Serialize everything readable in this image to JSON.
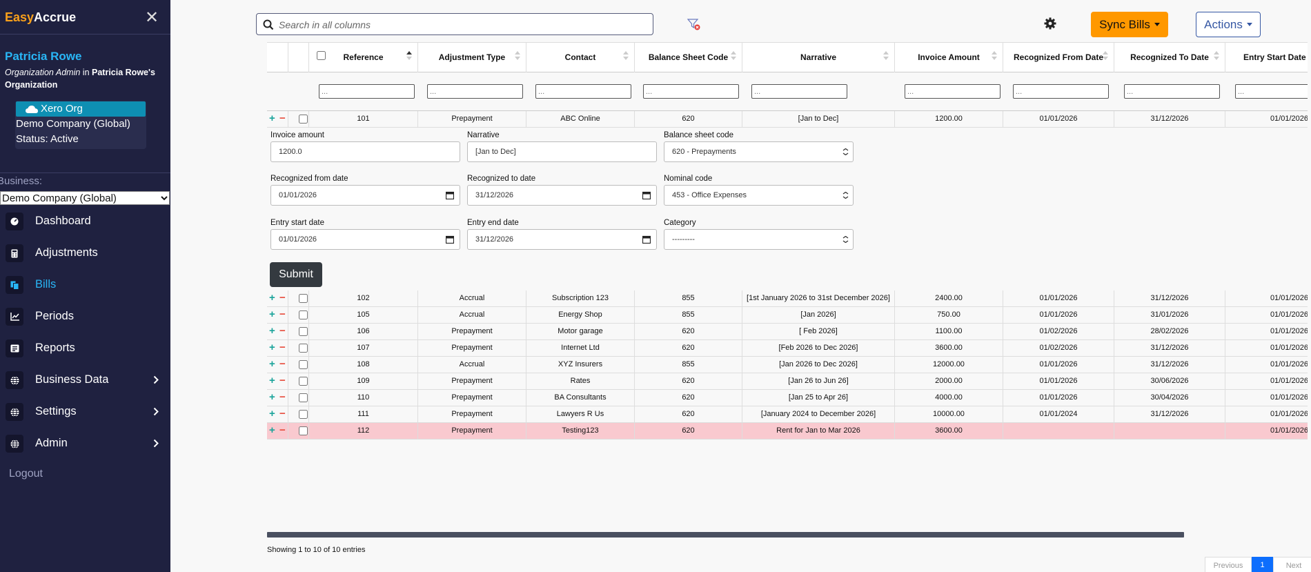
{
  "brand": {
    "part1": "Easy",
    "part2": "Accrue"
  },
  "user": {
    "name": "Patricia Rowe",
    "role": "Organization Admin",
    "in_text": " in ",
    "org_label": "Patricia Rowe's Organization"
  },
  "org": {
    "badge": "Xero Org",
    "name": "Demo Company (Global)",
    "status": "Status: Active"
  },
  "business": {
    "label": "Business:",
    "selected": "Demo Company (Global)"
  },
  "nav": [
    {
      "label": "Dashboard",
      "icon": "dashboard-icon"
    },
    {
      "label": "Adjustments",
      "icon": "calculator-icon"
    },
    {
      "label": "Bills",
      "icon": "bills-icon",
      "active": true
    },
    {
      "label": "Periods",
      "icon": "chart-icon"
    },
    {
      "label": "Reports",
      "icon": "report-icon"
    },
    {
      "label": "Business Data",
      "icon": "globe-icon",
      "expandable": true
    },
    {
      "label": "Settings",
      "icon": "globe-icon",
      "expandable": true
    },
    {
      "label": "Admin",
      "icon": "globe-icon",
      "expandable": true
    }
  ],
  "logout": "Logout",
  "search": {
    "placeholder": "Search in all columns"
  },
  "buttons": {
    "sync": "Sync Bills",
    "actions": "Actions",
    "submit": "Submit"
  },
  "table": {
    "columns": [
      "Reference",
      "Adjustment Type",
      "Contact",
      "Balance Sheet Code",
      "Narrative",
      "Invoice Amount",
      "Recognized From Date",
      "Recognized To Date",
      "Entry Start Date"
    ],
    "filter_placeholder": "...",
    "rows": [
      {
        "ref": "101",
        "type": "Prepayment",
        "contact": "ABC Online",
        "bsc": "620",
        "narr": "[Jan to Dec]",
        "amt": "1200.00",
        "from": "01/01/2026",
        "to": "31/12/2026",
        "start": "01/01/2026"
      },
      {
        "ref": "102",
        "type": "Accrual",
        "contact": "Subscription 123",
        "bsc": "855",
        "narr": "[1st January 2026 to 31st December 2026]",
        "amt": "2400.00",
        "from": "01/01/2026",
        "to": "31/12/2026",
        "start": "01/01/2026"
      },
      {
        "ref": "105",
        "type": "Accrual",
        "contact": "Energy Shop",
        "bsc": "855",
        "narr": "[Jan 2026]",
        "amt": "750.00",
        "from": "01/01/2026",
        "to": "31/01/2026",
        "start": "01/01/2026"
      },
      {
        "ref": "106",
        "type": "Prepayment",
        "contact": "Motor garage",
        "bsc": "620",
        "narr": "[ Feb 2026]",
        "amt": "1100.00",
        "from": "01/02/2026",
        "to": "28/02/2026",
        "start": "01/01/2026"
      },
      {
        "ref": "107",
        "type": "Prepayment",
        "contact": "Internet Ltd",
        "bsc": "620",
        "narr": "[Feb 2026 to Dec 2026]",
        "amt": "3600.00",
        "from": "01/02/2026",
        "to": "31/12/2026",
        "start": "01/01/2026"
      },
      {
        "ref": "108",
        "type": "Accrual",
        "contact": "XYZ Insurers",
        "bsc": "855",
        "narr": "[Jan 2026 to Dec 2026]",
        "amt": "12000.00",
        "from": "01/01/2026",
        "to": "31/12/2026",
        "start": "01/01/2026"
      },
      {
        "ref": "109",
        "type": "Prepayment",
        "contact": "Rates",
        "bsc": "620",
        "narr": "[Jan 26 to Jun 26]",
        "amt": "2000.00",
        "from": "01/01/2026",
        "to": "30/06/2026",
        "start": "01/01/2026"
      },
      {
        "ref": "110",
        "type": "Prepayment",
        "contact": "BA Consultants",
        "bsc": "620",
        "narr": "[Jan 25 to Apr 26]",
        "amt": "4000.00",
        "from": "01/01/2026",
        "to": "30/04/2026",
        "start": "01/01/2026"
      },
      {
        "ref": "111",
        "type": "Prepayment",
        "contact": "Lawyers R Us",
        "bsc": "620",
        "narr": "[January 2024 to December 2026]",
        "amt": "10000.00",
        "from": "01/01/2024",
        "to": "31/12/2026",
        "start": "01/01/2026"
      },
      {
        "ref": "112",
        "type": "Prepayment",
        "contact": "Testing123",
        "bsc": "620",
        "narr": "Rent for Jan to Mar 2026",
        "amt": "3600.00",
        "from": "",
        "to": "",
        "start": "01/01/2026",
        "highlight": true
      }
    ]
  },
  "form": {
    "invoice_amount_label": "Invoice amount",
    "invoice_amount": "1200.0",
    "narrative_label": "Narrative",
    "narrative": "[Jan to Dec]",
    "bsc_label": "Balance sheet code",
    "bsc": "620 - Prepayments",
    "from_label": "Recognized from date",
    "from": "01/01/2026",
    "to_label": "Recognized to date",
    "to": "31/12/2026",
    "nominal_label": "Nominal code",
    "nominal": "453 - Office Expenses",
    "start_label": "Entry start date",
    "start": "01/01/2026",
    "end_label": "Entry end date",
    "end": "31/12/2026",
    "category_label": "Category",
    "category": "---------"
  },
  "footer": {
    "info": "Showing 1 to 10 of 10 entries",
    "prev": "Previous",
    "page": "1",
    "next": "Next"
  },
  "colors": {
    "sidebar": "#1f2140",
    "accent": "#29b6f6",
    "sync": "#ff9800",
    "highlight_row": "#f9c9cf",
    "plus": "#19a39a",
    "minus": "#e74c3c"
  }
}
